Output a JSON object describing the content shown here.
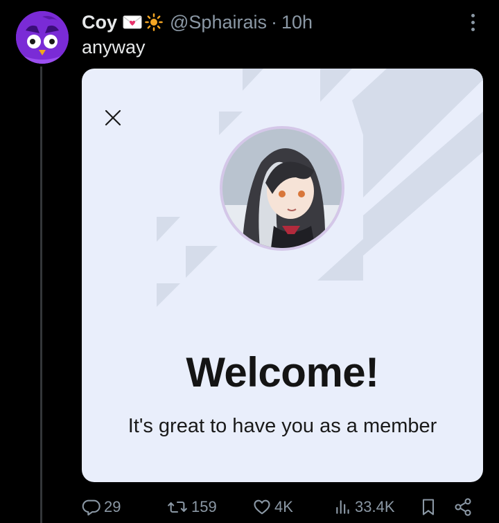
{
  "tweet": {
    "display_name": "Coy",
    "handle": "@Sphairais",
    "separator": "·",
    "time": "10h",
    "text": "anyway"
  },
  "card": {
    "title": "Welcome!",
    "subtitle": "It's great to have you as a member"
  },
  "actions": {
    "replies": "29",
    "reposts": "159",
    "likes": "4K",
    "views": "33.4K"
  },
  "icons": {
    "reply": "reply-icon",
    "repost": "repost-icon",
    "like": "heart-icon",
    "views": "views-icon",
    "bookmark": "bookmark-icon",
    "share": "share-icon",
    "more": "more-icon",
    "close": "close-icon"
  },
  "colors": {
    "background": "#000000",
    "card_background": "#e9eefb",
    "muted_text": "#8b98a5",
    "primary_text": "#e7e9ea",
    "avatar_purple": "#7a2bd6"
  }
}
